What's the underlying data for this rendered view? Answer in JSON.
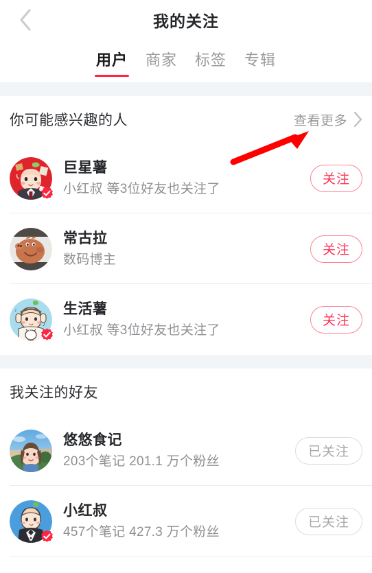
{
  "nav": {
    "back_icon": "chevron-left-icon",
    "title": "我的关注"
  },
  "tabs": [
    {
      "label": "用户",
      "active": true
    },
    {
      "label": "商家",
      "active": false
    },
    {
      "label": "标签",
      "active": false
    },
    {
      "label": "专辑",
      "active": false
    }
  ],
  "suggested_section": {
    "title": "你可能感兴趣的人",
    "more_label": "查看更多",
    "more_icon": "chevron-right-icon",
    "users": [
      {
        "name": "巨星薯",
        "subtitle": "小红叔 等3位好友也关注了",
        "verified": true,
        "button_label": "关注",
        "avatar": "cartoon-potato-red-bg"
      },
      {
        "name": "常古拉",
        "subtitle": "数码博主",
        "verified": false,
        "button_label": "关注",
        "avatar": "cartoon-pig-photo"
      },
      {
        "name": "生活薯",
        "subtitle": "小红叔 等3位好友也关注了",
        "verified": true,
        "button_label": "关注",
        "avatar": "cartoon-potato-headphones-blue-bg"
      }
    ]
  },
  "following_section": {
    "title": "我关注的好友",
    "users": [
      {
        "name": "悠悠食记",
        "subtitle": "203个笔记   201.1 万个粉丝",
        "verified": false,
        "button_label": "已关注",
        "avatar": "photo-person-blue-sky"
      },
      {
        "name": "小红叔",
        "subtitle": "457个笔记   427.3 万个粉丝",
        "verified": true,
        "button_label": "已关注",
        "avatar": "cartoon-potato-suit-blue-bg"
      }
    ]
  },
  "annotation": {
    "type": "arrow",
    "color": "#ff0000",
    "points_to": "查看更多"
  },
  "colors": {
    "accent": "#ff2442",
    "follow_border": "#ff8095",
    "follow_text": "#ff3355",
    "following_border": "#dcdcdc",
    "following_text": "#a6a8ab",
    "band": "#f1f5f8",
    "title_text": "#26282b",
    "muted_text": "#8e9093"
  }
}
